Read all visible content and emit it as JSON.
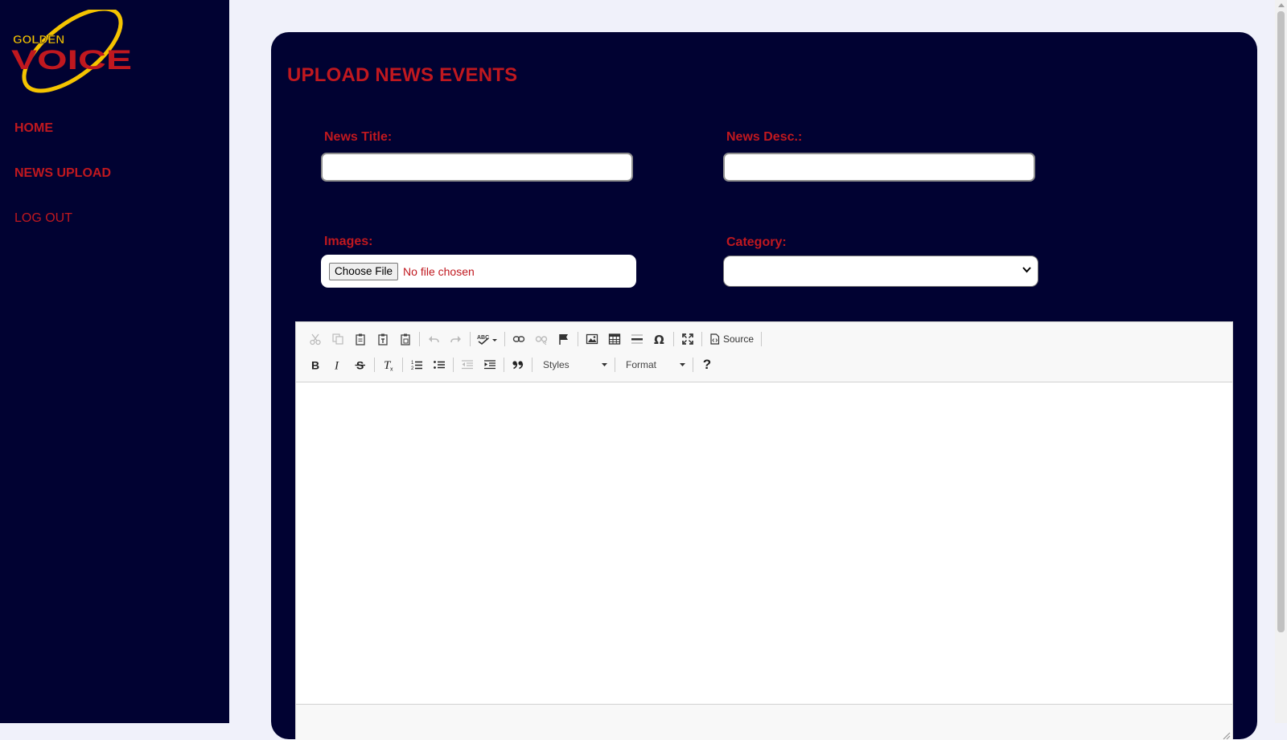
{
  "logo": {
    "line1": "GOLDEN",
    "line2": "VOICE"
  },
  "nav": {
    "items": [
      {
        "label": "HOME"
      },
      {
        "label": "NEWS UPLOAD"
      },
      {
        "label": "LOG OUT"
      }
    ]
  },
  "page": {
    "title": "UPLOAD NEWS EVENTS"
  },
  "form": {
    "news_title": {
      "label": "News Title:",
      "value": ""
    },
    "news_desc": {
      "label": "News Desc.:",
      "value": ""
    },
    "images": {
      "label": "Images:",
      "button_label": "Choose File",
      "status": "No file chosen"
    },
    "category": {
      "label": "Category:",
      "selected": ""
    }
  },
  "editor": {
    "toolbar": {
      "source_label": "Source",
      "styles_label": "Styles",
      "format_label": "Format",
      "help_label": "?"
    },
    "content": ""
  },
  "colors": {
    "sidebar_bg": "#010232",
    "panel_bg": "#010232",
    "accent_red": "#c0181f",
    "logo_gold": "#f5c400",
    "page_bg": "#f0f1fa"
  }
}
